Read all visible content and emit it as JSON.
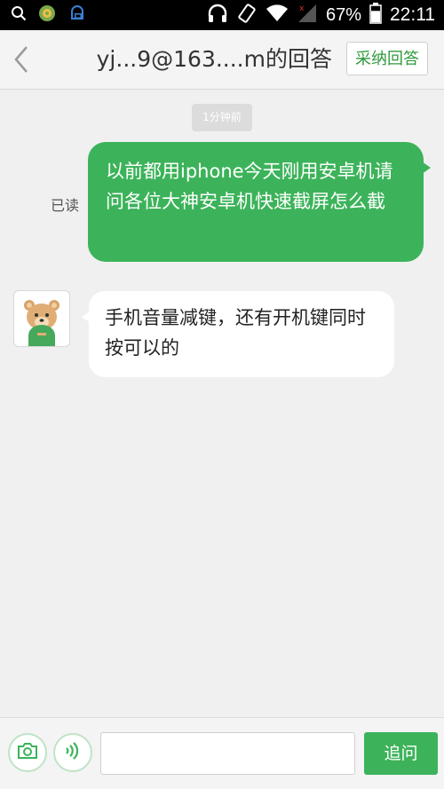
{
  "status_bar": {
    "battery_percent": "67%",
    "time": "22:11",
    "battery_level": 0.67
  },
  "header": {
    "title": "yj...9@163....m的回答",
    "accept_label": "采纳回答"
  },
  "chat": {
    "timestamp": "1分钟前",
    "read_status": "已读",
    "sent_message": "以前都用iphone今天刚用安卓机请问各位大神安卓机快速截屏怎么截",
    "received_message": "手机音量减键，还有开机键同时按可以的"
  },
  "bottom_bar": {
    "input_value": "",
    "input_placeholder": "",
    "ask_label": "追问"
  },
  "colors": {
    "accent": "#3cb35a",
    "status_bar_bg": "#000000",
    "chat_bg": "#f0f0f0"
  },
  "icons": {
    "status_bar": [
      "search-icon",
      "app-icon",
      "notification-icon",
      "headset-icon",
      "vibrate-icon",
      "wifi-icon",
      "signal-icon",
      "battery-icon"
    ],
    "header": [
      "back-chevron-icon"
    ],
    "bottom_bar": [
      "camera-icon",
      "voice-icon"
    ]
  }
}
